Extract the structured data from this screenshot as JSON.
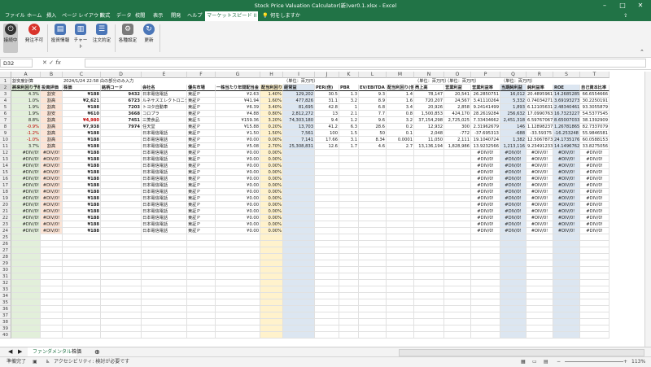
{
  "window": {
    "title": "Stock Price Valuation Calculator(新)ver0.1.xlsx - Excel"
  },
  "menu": {
    "tabs": [
      "ファイル",
      "ホーム",
      "挿入",
      "ページ レイアウト",
      "数式",
      "データ",
      "校閲",
      "表示",
      "開発",
      "ヘルプ",
      "マーケットスピード II"
    ],
    "active": 10,
    "search": "何をしますか"
  },
  "ribbon": {
    "buttons": [
      "接続中",
      "発注不可",
      "投資情報",
      "チャート",
      "注文約定",
      "各種設定",
      "更新"
    ]
  },
  "formula": {
    "namebox": "D32",
    "fx": "fx",
    "value": ""
  },
  "columns": [
    "A",
    "B",
    "C",
    "D",
    "E",
    "F",
    "G",
    "H",
    "I",
    "J",
    "K",
    "L",
    "M",
    "N",
    "O",
    "P",
    "Q",
    "R",
    "S",
    "T"
  ],
  "rows": [
    "1",
    "2",
    "3",
    "4",
    "5",
    "6",
    "7",
    "8",
    "9",
    "10",
    "11",
    "12",
    "13",
    "14",
    "15",
    "16",
    "17",
    "18",
    "19",
    "20",
    "21",
    "22",
    "23",
    "24",
    "25",
    "26",
    "27",
    "28",
    "29",
    "30",
    "31",
    "32",
    "33",
    "34",
    "35",
    "36",
    "37",
    "38",
    "39",
    "40"
  ],
  "row1": {
    "a": "割安度計算",
    "b": "2024/1/24 22:58 白の部分のみ入力",
    "i": "（単位：百万円）",
    "n": "（単位：百万円）",
    "o": "（単位：百万円）",
    "q": "（単位：百万円）"
  },
  "headers": [
    "將来利回り予想",
    "投資評価",
    "株価",
    "銘柄コード",
    "会社名",
    "優先市場",
    "一株当たり年間配当金",
    "配当利回り",
    "経常益",
    "PER(倍)",
    "PBR",
    "EV/EBITDA",
    "配当利回り(倍)",
    "売上高",
    "営業利益",
    "営業利益率",
    "当期純利益",
    "純利益率",
    "ROE",
    "自己資本比率"
  ],
  "data_rows": [
    [
      "4.3%",
      "割安",
      "¥188",
      "9432",
      "日本電信電話",
      "東証Ｐ",
      "¥2.63",
      "1.40%",
      "129,202",
      "30.5",
      "1.3",
      "9.3",
      "1.4",
      "78,147",
      "20,541",
      "26.2850751",
      "16,012",
      "20.4895961",
      "14.2685285",
      "66.6554666"
    ],
    [
      "1.0%",
      "割高",
      "¥2,621",
      "6723",
      "ルネサスエレクトロニクス",
      "東証Ｐ",
      "¥41.94",
      "1.60%",
      "477,826",
      "31.1",
      "3.2",
      "8.9",
      "1.6",
      "720,207",
      "24,567",
      "3.41110264",
      "5,332",
      "0.74034271",
      "3.69193273",
      "30.2250191"
    ],
    [
      "1.9%",
      "割高",
      "¥188",
      "7203",
      "トヨタ自動車",
      "東証Ｐ",
      "¥6.39",
      "3.40%",
      "81,695",
      "42.8",
      "1",
      "6.8",
      "3.4",
      "20,926",
      "2,858",
      "9.24141499",
      "1,893",
      "6.12105631",
      "2.48340461",
      "93.3055879"
    ],
    [
      "1.9%",
      "割安",
      "¥610",
      "3668",
      "コロプラ",
      "東証Ｐ",
      "¥4.88",
      "0.80%",
      "2,812,272",
      "13",
      "2.1",
      "7.7",
      "0.8",
      "1,500,853",
      "424,170",
      "28.2619284",
      "256,632",
      "17.0990763",
      "16.7323227",
      "54.5377545"
    ],
    [
      "8.8%",
      "割高",
      "¥4,980",
      "7451",
      "三菱食品",
      "東証Ｓ",
      "¥159.36",
      "3.20%",
      "74,303,180",
      "9.4",
      "1.2",
      "9.6",
      "3.2",
      "37,154,298",
      "2,725,025",
      "7.33434662",
      "2,451,318",
      "6.59767067",
      "8.65007033",
      "38.1392909"
    ],
    [
      "-0.9%",
      "割高",
      "¥7,938",
      "7974",
      "任天堂",
      "東証Ｐ",
      "¥15.88",
      "0.20%",
      "13,703",
      "41.2",
      "6.3",
      "28.6",
      "0.2",
      "12,932",
      "300",
      "2.31962679",
      "146",
      "1.12898237",
      "1.26781865",
      "82.7337079"
    ],
    [
      "-1.2%",
      "割高",
      "¥188",
      "",
      "日本電信電話",
      "東証Ｐ",
      "¥1.50",
      "1.50%",
      "7,561",
      "100",
      "1.5",
      "50",
      "0.1",
      "2,048",
      "-772",
      "-37.695313",
      "-688",
      "-33.59375",
      "-16.253248",
      "55.9846581"
    ],
    [
      "-1.0%",
      "割高",
      "¥188",
      "",
      "日本電信電話",
      "東証Ｐ",
      "¥0.00",
      "0.00%",
      "7,141",
      "17.66",
      "3.1",
      "8.34",
      "0.0001",
      "11,050",
      "2,111",
      "19.1040724",
      "1,382",
      "12.5067873",
      "24.1735176",
      "60.0588153"
    ],
    [
      "3.7%",
      "割高",
      "¥188",
      "",
      "日本電信電話",
      "東証Ｐ",
      "¥5.08",
      "2.70%",
      "25,308,831",
      "12.6",
      "1.7",
      "4.6",
      "2.7",
      "13,136,194",
      "1,828,986",
      "13.9232566",
      "1,213,116",
      "9.23491233",
      "14.1496762",
      "33.8275056"
    ]
  ],
  "error_rows": {
    "count": 13,
    "a": "#DIV/0!",
    "b": "#DIV/0!",
    "c": "¥188",
    "e": "日本電信電話",
    "f": "東証Ｐ",
    "g": "¥0.00",
    "h": "0.00%",
    "err": "#DIV/0!"
  },
  "sheets": {
    "tabs": [
      "ファンダメンタル",
      "株価"
    ],
    "active": 0
  },
  "status": {
    "ready": "準備完了",
    "accessibility": "アクセシビリティ: 検討が必要です",
    "zoom": "113%"
  },
  "colors": {
    "excel_green": "#217346",
    "yellow_col": "#fff2cc",
    "blue_col": "#dce6f1",
    "green_col": "#e2efda",
    "salmon_col": "#fce4d6"
  }
}
